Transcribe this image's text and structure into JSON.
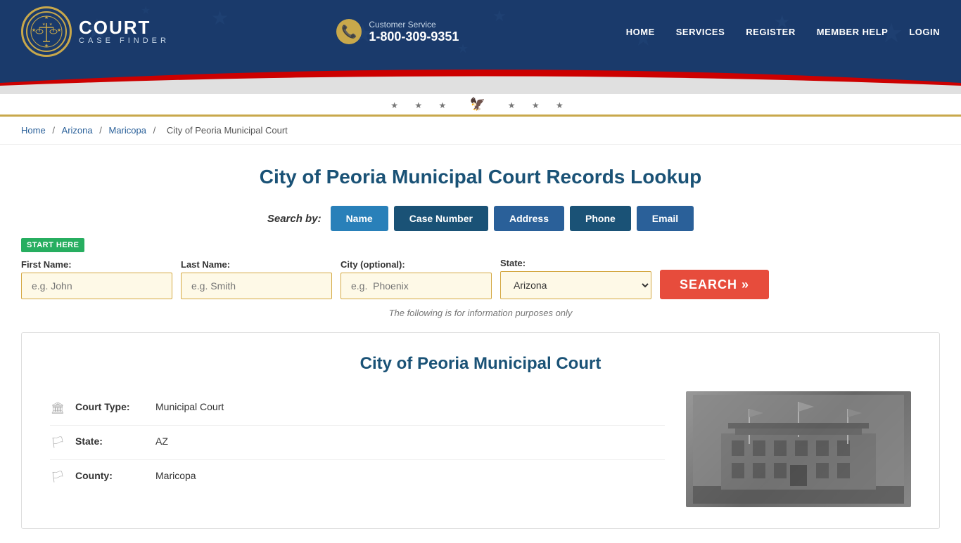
{
  "header": {
    "logo_court": "COURT",
    "logo_sub": "CASE FINDER",
    "customer_service_label": "Customer Service",
    "customer_service_phone": "1-800-309-9351",
    "nav": {
      "home": "HOME",
      "services": "SERVICES",
      "register": "REGISTER",
      "member_help": "MEMBER HELP",
      "login": "LOGIN"
    }
  },
  "breadcrumb": {
    "home": "Home",
    "state": "Arizona",
    "county": "Maricopa",
    "current": "City of Peoria Municipal Court"
  },
  "page": {
    "title": "City of Peoria Municipal Court Records Lookup"
  },
  "search": {
    "by_label": "Search by:",
    "tabs": [
      {
        "id": "name",
        "label": "Name",
        "active": true
      },
      {
        "id": "case_number",
        "label": "Case Number",
        "active": false
      },
      {
        "id": "address",
        "label": "Address",
        "active": false
      },
      {
        "id": "phone",
        "label": "Phone",
        "active": false
      },
      {
        "id": "email",
        "label": "Email",
        "active": false
      }
    ],
    "start_here": "START HERE",
    "fields": {
      "first_name_label": "First Name:",
      "first_name_placeholder": "e.g. John",
      "last_name_label": "Last Name:",
      "last_name_placeholder": "e.g. Smith",
      "city_label": "City (optional):",
      "city_placeholder": "e.g.  Phoenix",
      "state_label": "State:",
      "state_value": "Arizona"
    },
    "search_button": "SEARCH »",
    "info_text": "The following is for information purposes only"
  },
  "court_info": {
    "title": "City of Peoria Municipal Court",
    "details": [
      {
        "icon": "🏛",
        "label": "Court Type:",
        "value": "Municipal Court"
      },
      {
        "icon": "🏳",
        "label": "State:",
        "value": "AZ"
      },
      {
        "icon": "🏳",
        "label": "County:",
        "value": "Maricopa"
      }
    ]
  }
}
